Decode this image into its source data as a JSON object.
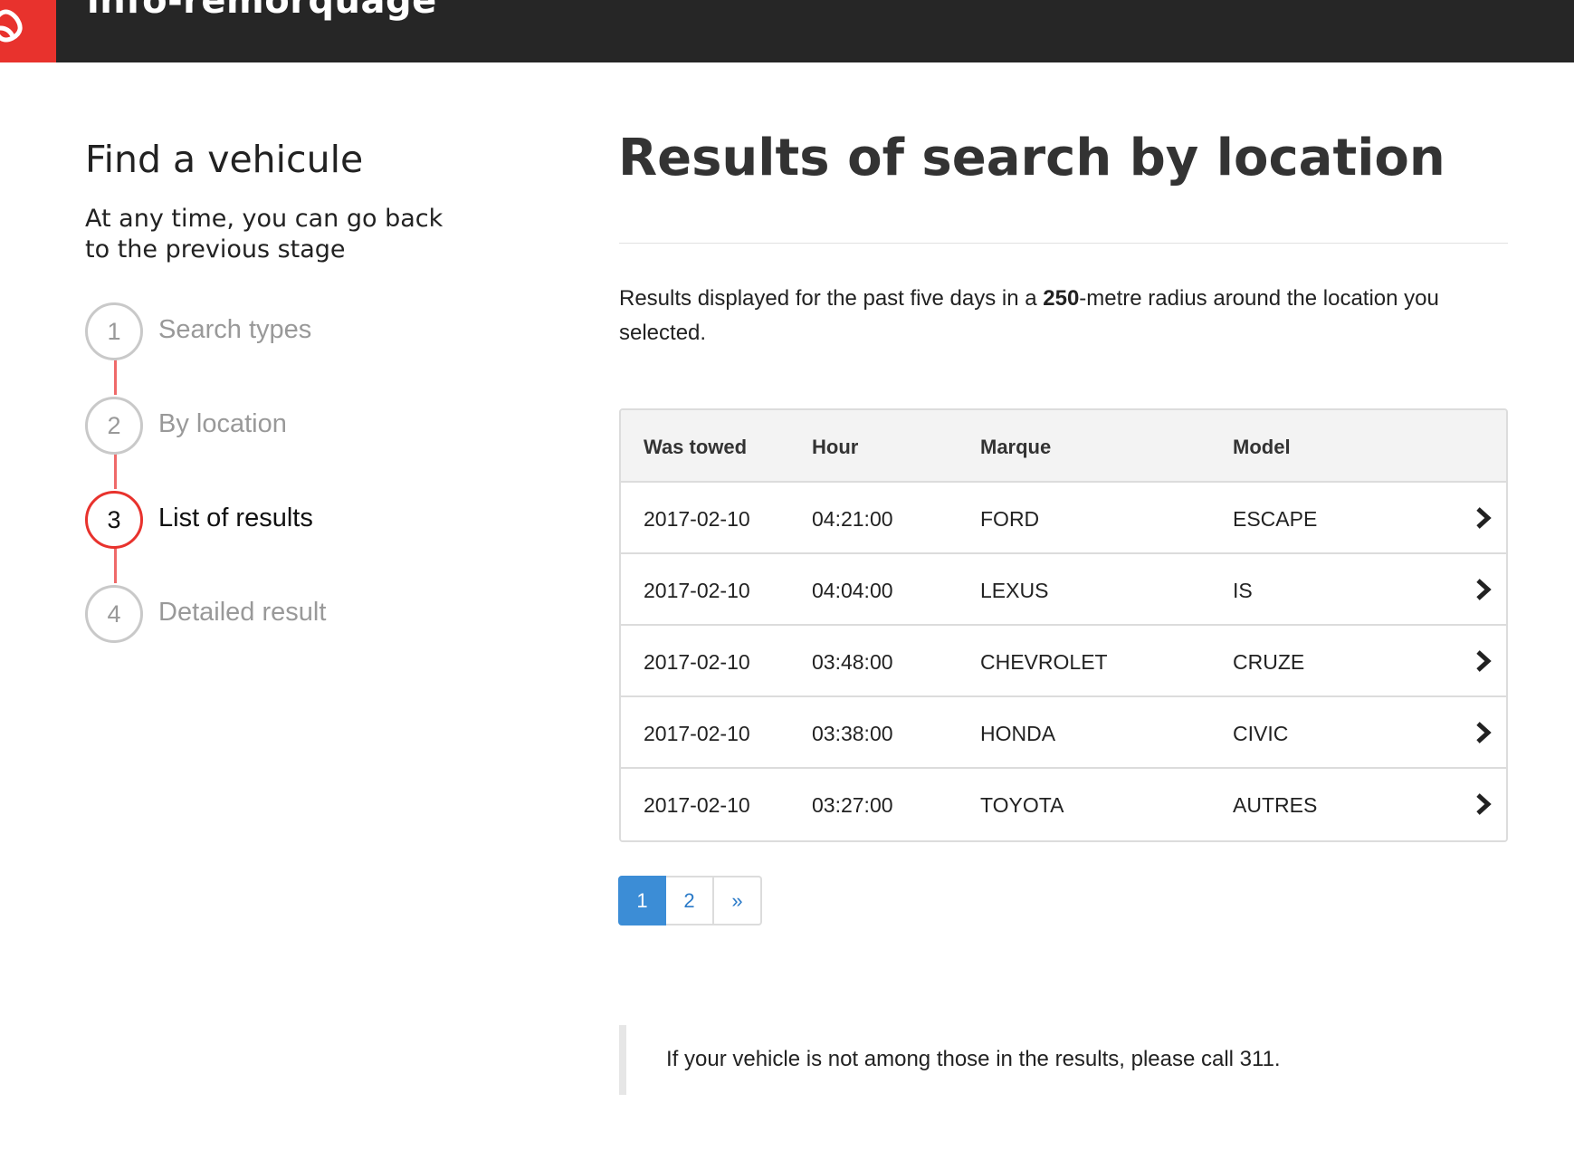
{
  "header": {
    "app_title": "info-remorquage"
  },
  "sidebar": {
    "title": "Find a vehicule",
    "subtitle": "At any time, you can go back to the previous stage",
    "steps": [
      {
        "number": "1",
        "label": "Search types",
        "active": false
      },
      {
        "number": "2",
        "label": "By location",
        "active": false
      },
      {
        "number": "3",
        "label": "List of results",
        "active": true
      },
      {
        "number": "4",
        "label": "Detailed result",
        "active": false
      }
    ]
  },
  "main": {
    "title": "Results of search by location",
    "intro_before": "Results displayed for the past five days in a ",
    "intro_bold": "250",
    "intro_after": "-metre radius around the location you selected.",
    "table": {
      "headers": [
        "Was towed",
        "Hour",
        "Marque",
        "Model"
      ],
      "rows": [
        [
          "2017-02-10",
          "04:21:00",
          "FORD",
          "ESCAPE"
        ],
        [
          "2017-02-10",
          "04:04:00",
          "LEXUS",
          "IS"
        ],
        [
          "2017-02-10",
          "03:48:00",
          "CHEVROLET",
          "CRUZE"
        ],
        [
          "2017-02-10",
          "03:38:00",
          "HONDA",
          "CIVIC"
        ],
        [
          "2017-02-10",
          "03:27:00",
          "TOYOTA",
          "AUTRES"
        ]
      ]
    },
    "pagination": [
      "1",
      "2",
      "»"
    ],
    "note": "If your vehicle is not among those in the results, please call 311."
  },
  "colors": {
    "brand_red": "#e8322d",
    "header_bg": "#262626",
    "link_blue": "#3c8dd6"
  }
}
